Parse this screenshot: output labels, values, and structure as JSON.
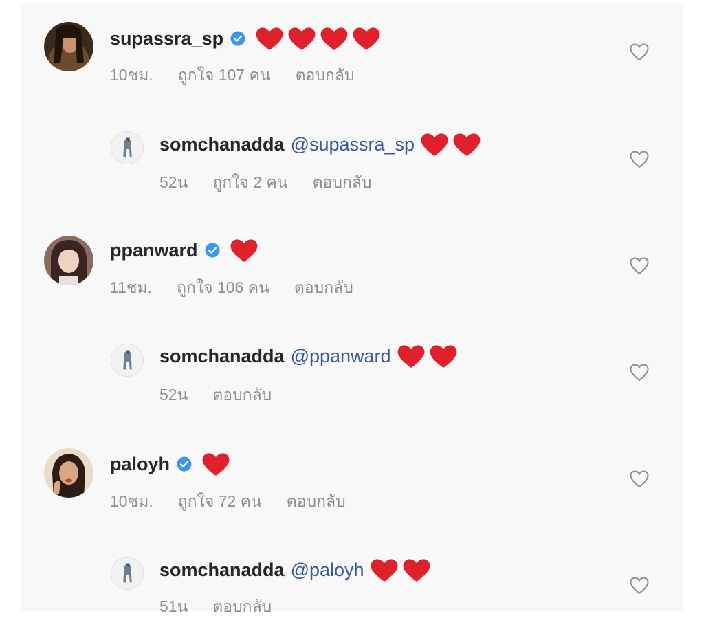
{
  "comments": [
    {
      "username": "supassra_sp",
      "verified": true,
      "hearts": 4,
      "time": "10ชม.",
      "likes": "ถูกใจ 107 คน",
      "reply_label": "ตอบกลับ",
      "reply": {
        "username": "somchanadda",
        "mention": "@supassra_sp",
        "hearts": 2,
        "time": "52น",
        "likes": "ถูกใจ 2 คน",
        "reply_label": "ตอบกลับ"
      }
    },
    {
      "username": "ppanward",
      "verified": true,
      "hearts": 1,
      "time": "11ชม.",
      "likes": "ถูกใจ 106 คน",
      "reply_label": "ตอบกลับ",
      "reply": {
        "username": "somchanadda",
        "mention": "@ppanward",
        "hearts": 2,
        "time": "52น",
        "reply_label": "ตอบกลับ"
      }
    },
    {
      "username": "paloyh",
      "verified": true,
      "hearts": 1,
      "time": "10ชม.",
      "likes": "ถูกใจ 72 คน",
      "reply_label": "ตอบกลับ",
      "reply": {
        "username": "somchanadda",
        "mention": "@paloyh",
        "hearts": 2,
        "time": "51น",
        "reply_label": "ตอบกลับ"
      }
    }
  ],
  "icons": {
    "verified": "verified-badge-icon",
    "heart_emoji": "red-heart-emoji",
    "like": "heart-outline-icon"
  },
  "colors": {
    "verified_blue": "#3897f0",
    "heart_red": "#e0202a",
    "mention_blue": "#385898",
    "meta_gray": "#8e8e8e"
  }
}
